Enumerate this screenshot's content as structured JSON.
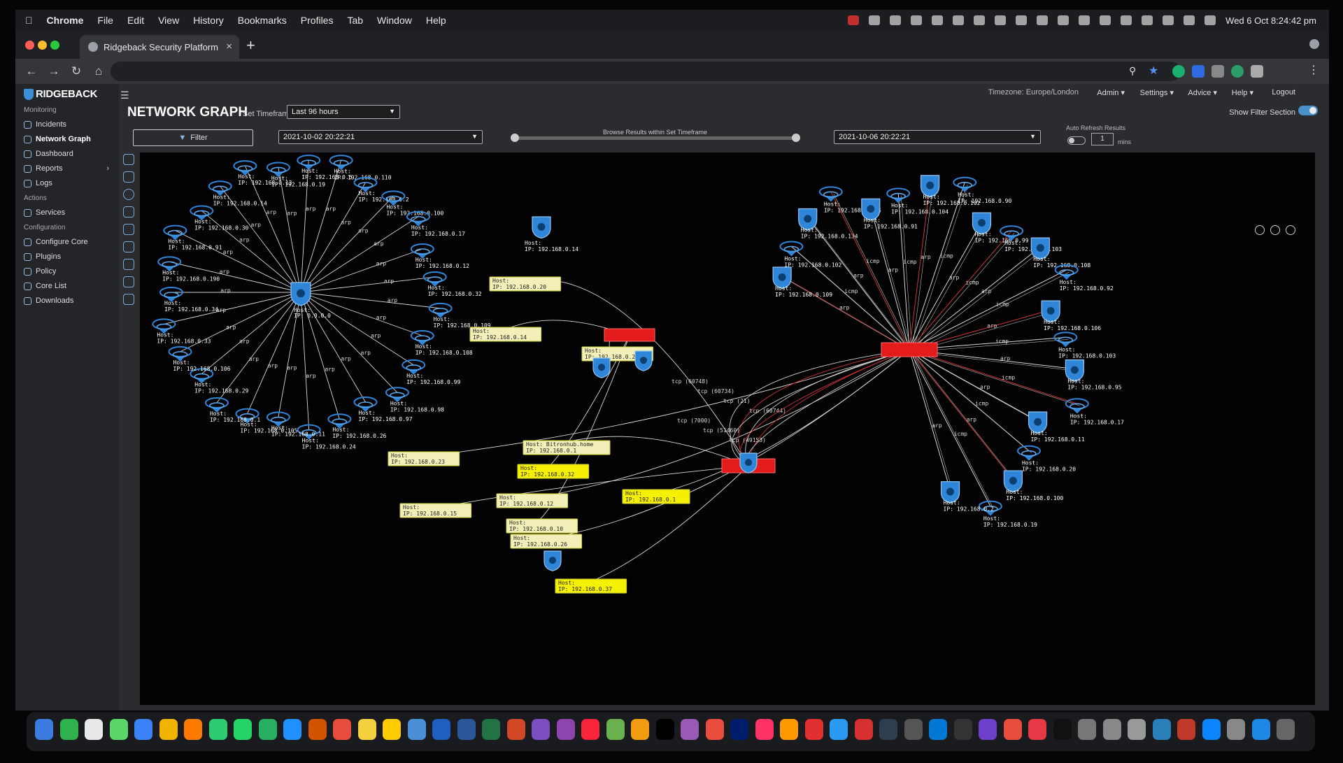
{
  "menubar": {
    "items": [
      "Chrome",
      "File",
      "Edit",
      "View",
      "History",
      "Bookmarks",
      "Profiles",
      "Tab",
      "Window",
      "Help"
    ],
    "clock": "Wed 6 Oct  8:24:42 pm"
  },
  "browser": {
    "tab_title": "Ridgeback Security Platform"
  },
  "sidebar": {
    "logo": "RIDGEBACK",
    "monitoring": "Monitoring",
    "actions": "Actions",
    "configuration": "Configuration",
    "items": [
      "Incidents",
      "Network Graph",
      "Dashboard",
      "Reports",
      "Logs",
      "Services",
      "Configure Core",
      "Plugins",
      "Policy",
      "Core List",
      "Downloads"
    ]
  },
  "topbar": {
    "timezone": "Timezone: Europe/London",
    "admin": "Admin",
    "settings": "Settings",
    "advice": "Advice",
    "help": "Help",
    "logout": "Logout"
  },
  "page": {
    "title": "NETWORK GRAPH",
    "timeframe_label": "Set Timeframe",
    "timeframe_value": "Last 96 hours",
    "filter_label": "Filter",
    "start_date": "2021-10-02 20:22:21",
    "end_date": "2021-10-06 20:22:21",
    "browse_label": "Browse Results within Set Timeframe",
    "auto_refresh_label": "Auto Refresh Results",
    "refresh_value": "1",
    "mins_label": "mins",
    "show_filter": "Show Filter Section"
  },
  "graph": {
    "center_left": "IP: 0.0.0.0",
    "host_prefix": "Host:",
    "edge_arp": "arp",
    "edge_icmp": "icmp",
    "left_hosts": [
      "192.168.0.19",
      "192.168.0.5",
      "192.168.0.110",
      "192.168.0.2",
      "192.168.0.100",
      "192.168.0.17",
      "192.168.0.12",
      "192.168.0.32",
      "192.168.0.109",
      "192.168.0.108",
      "192.168.0.99",
      "192.168.0.98",
      "192.168.0.97",
      "192.168.0.26",
      "192.168.0.24",
      "192.168.0.11",
      "192.168.0.105",
      "192.168.0.1",
      "192.168.0.29",
      "192.168.0.106",
      "192.168.0.33",
      "192.168.0.34",
      "192.168.0.190",
      "192.168.0.91",
      "192.168.0.30",
      "192.168.0.14",
      "192.168.0.13"
    ],
    "mid_labels": [
      {
        "host": "Host:",
        "ip": "IP: 192.168.0.20"
      },
      {
        "host": "Host:",
        "ip": "IP: 192.168.0.14"
      },
      {
        "host": "Host:",
        "ip": "IP: 192.168.0.23"
      },
      {
        "host": "Host: Bitronhub.home",
        "ip": "IP: 192.168.0.1"
      },
      {
        "host": "Host:",
        "ip": "IP: 192.168.0.32"
      },
      {
        "host": "Host:",
        "ip": "IP: 192.168.0.12"
      },
      {
        "host": "Host:",
        "ip": "IP: 192.168.0.15"
      },
      {
        "host": "Host:",
        "ip": "IP: 192.168.0.10"
      },
      {
        "host": "Host:",
        "ip": "IP: 192.168.0.26"
      },
      {
        "host": "Host:",
        "ip": "IP: 192.168.0.37"
      },
      {
        "host": "Host:",
        "ip": "IP: 192.168.0.24"
      },
      {
        "host": "Host:",
        "ip": "IP: 192.168.0.1"
      }
    ],
    "right_hosts": [
      "192.168.0.109",
      "192.168.0.102",
      "192.168.0.134",
      "192.168.0.104",
      "192.168.0.91",
      "192.168.0.104",
      "192.168.0.102",
      "192.168.0.90",
      "192.168.0.99",
      "192.168.0.103",
      "192.168.0.108",
      "192.168.0.92",
      "192.168.0.106",
      "192.168.0.103",
      "192.168.0.95",
      "192.168.0.17",
      "192.168.0.11",
      "192.168.0.20",
      "192.168.0.100",
      "192.168.0.19",
      "192.168.0.2"
    ],
    "proto_labels": [
      "tcp (60748)",
      "tcp (60734)",
      "tcp (21)",
      "tcp (60744)",
      "tcp (7000)",
      "tcp (51460)",
      "tcp (49153)"
    ]
  }
}
